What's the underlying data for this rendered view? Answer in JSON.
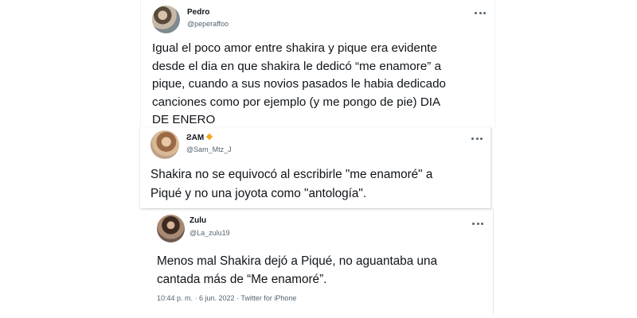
{
  "tweets": [
    {
      "name": "Pedro",
      "handle": "@peperaffoo",
      "text": "Igual el poco amor entre shakira y pique era evidente\ndesde el dia en que shakira le dedicó “me enamore” a\npique, cuando a sus novios pasados le habia dedicado\ncanciones como por ejemplo (y me pongo de pie) DIA\nDE ENERO"
    },
    {
      "name": "ƧAM",
      "handle": "@Sam_Mtz_J",
      "verified_color": "#f4a623",
      "text": "Shakira no se equivocó al escribirle \"me enamoré\" a\nPiqué y no una joyota como \"antología\"."
    },
    {
      "name": "Zulu",
      "handle": "@La_zulu19",
      "text": "Menos mal Shakira dejó a Piqué, no aguantaba una\ncantada más de “Me enamoré”.",
      "meta": "10:44 p. m. · 6 jun. 2022 · Twitter for iPhone"
    }
  ],
  "icons": {
    "more": "more-horizontal-icon",
    "verified": "verified-badge-icon"
  }
}
